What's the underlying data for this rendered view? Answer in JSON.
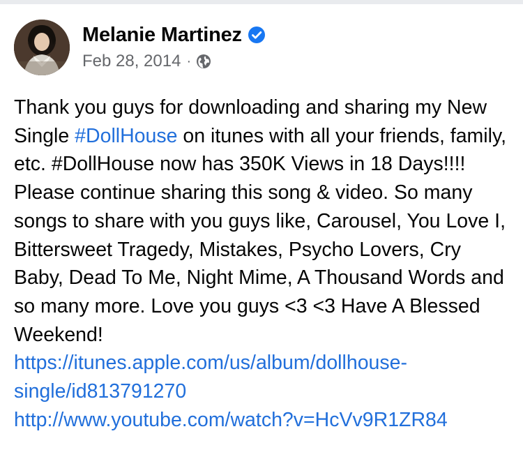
{
  "post": {
    "author": "Melanie Martinez",
    "verified_icon": "verified-badge-icon",
    "date": "Feb 28, 2014",
    "separator": "·",
    "audience_icon": "globe-icon",
    "text_part1": "Thank you guys for downloading and sharing my New Single ",
    "hashtag1": "#DollHouse",
    "text_part2": " on itunes with all your friends, family, etc. #DollHouse  now has 350K Views in 18 Days!!!! Please continue sharing this song & video. So many songs to share with you guys like, Carousel, You Love I, Bittersweet Tragedy, Mistakes, Psycho Lovers, Cry Baby, Dead To Me, Night Mime, A Thousand Words and so many more. Love you guys <3 <3 Have A Blessed Weekend!",
    "link1": "https://itunes.apple.com/us/album/dollhouse-single/id813791270",
    "link2": "http://www.youtube.com/watch?v=HcVv9R1ZR84"
  },
  "colors": {
    "link": "#216fdb",
    "verified": "#1877f2",
    "meta": "#65676b",
    "text": "#050505"
  }
}
